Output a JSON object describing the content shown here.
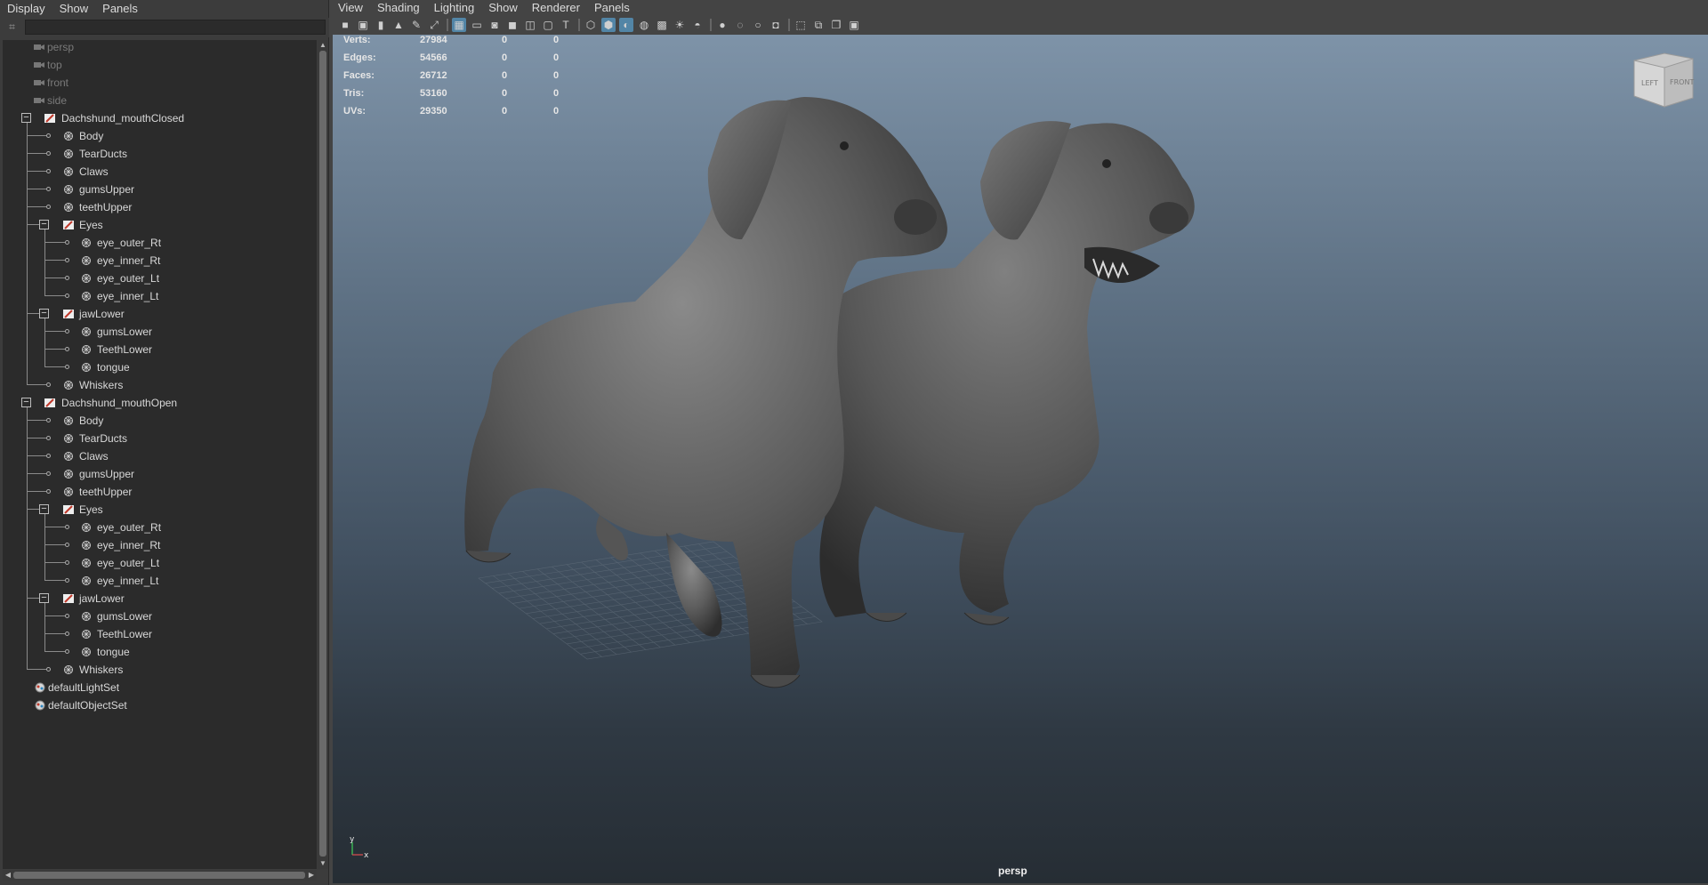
{
  "outliner": {
    "menu": [
      "Display",
      "Show",
      "Panels"
    ],
    "filter_value": "",
    "items": [
      {
        "label": "persp",
        "depth": 0,
        "type": "camera",
        "dim": true
      },
      {
        "label": "top",
        "depth": 0,
        "type": "camera",
        "dim": true
      },
      {
        "label": "front",
        "depth": 0,
        "type": "camera",
        "dim": true
      },
      {
        "label": "side",
        "depth": 0,
        "type": "camera",
        "dim": true
      },
      {
        "label": "Dachshund_mouthClosed",
        "depth": 0,
        "type": "group",
        "expanded": true
      },
      {
        "label": "Body",
        "depth": 1,
        "type": "mesh"
      },
      {
        "label": "TearDucts",
        "depth": 1,
        "type": "mesh"
      },
      {
        "label": "Claws",
        "depth": 1,
        "type": "mesh"
      },
      {
        "label": "gumsUpper",
        "depth": 1,
        "type": "mesh"
      },
      {
        "label": "teethUpper",
        "depth": 1,
        "type": "mesh"
      },
      {
        "label": "Eyes",
        "depth": 1,
        "type": "group",
        "expanded": true
      },
      {
        "label": "eye_outer_Rt",
        "depth": 2,
        "type": "mesh"
      },
      {
        "label": "eye_inner_Rt",
        "depth": 2,
        "type": "mesh"
      },
      {
        "label": "eye_outer_Lt",
        "depth": 2,
        "type": "mesh"
      },
      {
        "label": "eye_inner_Lt",
        "depth": 2,
        "type": "mesh"
      },
      {
        "label": "jawLower",
        "depth": 1,
        "type": "group",
        "expanded": true
      },
      {
        "label": "gumsLower",
        "depth": 2,
        "type": "mesh"
      },
      {
        "label": "TeethLower",
        "depth": 2,
        "type": "mesh"
      },
      {
        "label": "tongue",
        "depth": 2,
        "type": "mesh"
      },
      {
        "label": "Whiskers",
        "depth": 1,
        "type": "mesh"
      },
      {
        "label": "Dachshund_mouthOpen",
        "depth": 0,
        "type": "group",
        "expanded": true
      },
      {
        "label": "Body",
        "depth": 1,
        "type": "mesh"
      },
      {
        "label": "TearDucts",
        "depth": 1,
        "type": "mesh"
      },
      {
        "label": "Claws",
        "depth": 1,
        "type": "mesh"
      },
      {
        "label": "gumsUpper",
        "depth": 1,
        "type": "mesh"
      },
      {
        "label": "teethUpper",
        "depth": 1,
        "type": "mesh"
      },
      {
        "label": "Eyes",
        "depth": 1,
        "type": "group",
        "expanded": true
      },
      {
        "label": "eye_outer_Rt",
        "depth": 2,
        "type": "mesh"
      },
      {
        "label": "eye_inner_Rt",
        "depth": 2,
        "type": "mesh"
      },
      {
        "label": "eye_outer_Lt",
        "depth": 2,
        "type": "mesh"
      },
      {
        "label": "eye_inner_Lt",
        "depth": 2,
        "type": "mesh"
      },
      {
        "label": "jawLower",
        "depth": 1,
        "type": "group",
        "expanded": true
      },
      {
        "label": "gumsLower",
        "depth": 2,
        "type": "mesh"
      },
      {
        "label": "TeethLower",
        "depth": 2,
        "type": "mesh"
      },
      {
        "label": "tongue",
        "depth": 2,
        "type": "mesh"
      },
      {
        "label": "Whiskers",
        "depth": 1,
        "type": "mesh"
      },
      {
        "label": "defaultLightSet",
        "depth": 0,
        "type": "set"
      },
      {
        "label": "defaultObjectSet",
        "depth": 0,
        "type": "set"
      }
    ]
  },
  "viewport": {
    "menu": [
      "View",
      "Shading",
      "Lighting",
      "Show",
      "Renderer",
      "Panels"
    ],
    "camera_name": "persp",
    "viewcube": {
      "left": "LEFT",
      "front": "FRONT"
    },
    "axis": {
      "y": "y",
      "x": "x"
    },
    "hud": [
      {
        "label": "Verts:",
        "values": [
          "27984",
          "0",
          "0"
        ]
      },
      {
        "label": "Edges:",
        "values": [
          "54566",
          "0",
          "0"
        ]
      },
      {
        "label": "Faces:",
        "values": [
          "26712",
          "0",
          "0"
        ]
      },
      {
        "label": "Tris:",
        "values": [
          "53160",
          "0",
          "0"
        ]
      },
      {
        "label": "UVs:",
        "values": [
          "29350",
          "0",
          "0"
        ]
      }
    ],
    "toolbar_icons": [
      "camera-icon",
      "camera-attributes-icon",
      "bookmark-icon",
      "image-plane-icon",
      "grease-pencil-icon",
      "2d-pan-zoom-icon",
      "grid-icon",
      "film-gate-icon",
      "resolution-gate-icon",
      "gate-mask-icon",
      "field-chart-icon",
      "safe-action-icon",
      "safe-title-icon",
      "wireframe-icon",
      "smooth-shade-icon",
      "default-material-icon",
      "wireframe-on-shaded-icon",
      "xray-icon",
      "use-lights-icon",
      "shadows-icon",
      "screen-space-ao-icon",
      "motion-blur-icon",
      "anti-aliasing-icon",
      "depth-of-field-icon",
      "isolate-select-icon",
      "xray-joints-icon",
      "xray-active-icon",
      "panel-layout-icon"
    ],
    "active_toolbar_icons": [
      "grid-icon",
      "smooth-shade-icon",
      "default-material-icon"
    ],
    "colors": {
      "accent": "#5285a6",
      "bg_top": "#7e93a8",
      "bg_bottom": "#262d34",
      "mesh": "#5a5a5a"
    }
  }
}
